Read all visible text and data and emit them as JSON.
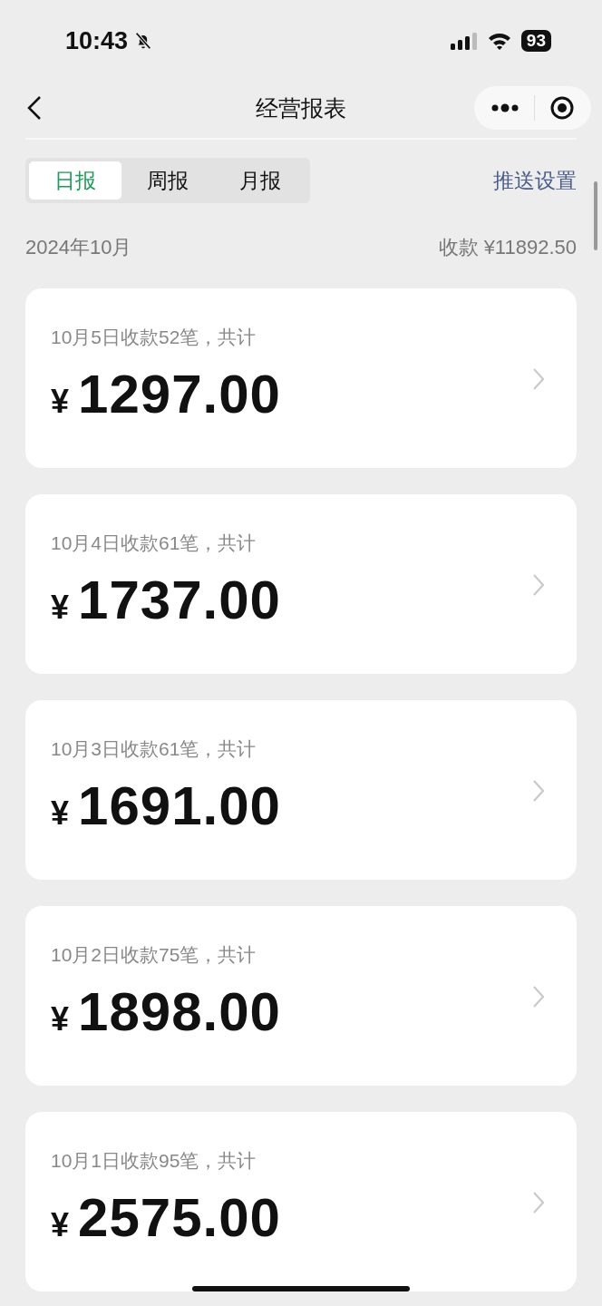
{
  "status_bar": {
    "time": "10:43",
    "silenced": true,
    "battery": "93"
  },
  "nav": {
    "title": "经营报表"
  },
  "tabs": [
    {
      "label": "日报",
      "selected": true
    },
    {
      "label": "周报",
      "selected": false
    },
    {
      "label": "月报",
      "selected": false
    }
  ],
  "push_settings": "推送设置",
  "summary": {
    "month": "2024年10月",
    "total": "收款 ¥11892.50"
  },
  "reports": [
    {
      "caption": "10月5日收款52笔，共计",
      "currency": "¥",
      "amount": "1297.00"
    },
    {
      "caption": "10月4日收款61笔，共计",
      "currency": "¥",
      "amount": "1737.00"
    },
    {
      "caption": "10月3日收款61笔，共计",
      "currency": "¥",
      "amount": "1691.00"
    },
    {
      "caption": "10月2日收款75笔，共计",
      "currency": "¥",
      "amount": "1898.00"
    },
    {
      "caption": "10月1日收款95笔，共计",
      "currency": "¥",
      "amount": "2575.00"
    }
  ]
}
